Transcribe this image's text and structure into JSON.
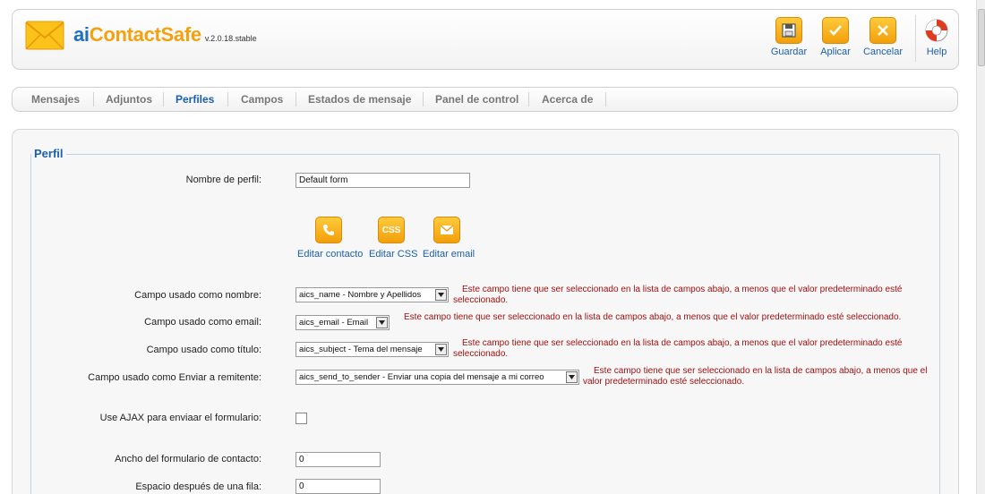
{
  "header": {
    "brand_ai": "ai",
    "brand_rest": "ContactSafe",
    "version": "v.2.0.18.stable",
    "buttons": {
      "save": "Guardar",
      "apply": "Aplicar",
      "cancel": "Cancelar",
      "help": "Help"
    }
  },
  "tabs": [
    {
      "label": "Mensajes"
    },
    {
      "label": "Adjuntos"
    },
    {
      "label": "Perfiles"
    },
    {
      "label": "Campos"
    },
    {
      "label": "Estados de mensaje"
    },
    {
      "label": "Panel de control"
    },
    {
      "label": "Acerca de"
    }
  ],
  "active_tab": "Perfiles",
  "form": {
    "legend": "Perfil",
    "profile_name_label": "Nombre de perfil:",
    "profile_name_value": "Default form",
    "actions": {
      "edit_contact": "Editar contacto",
      "edit_css": "Editar CSS",
      "edit_css_icon_text": "CSS",
      "edit_email": "Editar email"
    },
    "name_field_label": "Campo usado como nombre:",
    "name_field_value": "aics_name - Nombre y Apellidos",
    "email_field_label": "Campo usado como email:",
    "email_field_value": "aics_email - Email",
    "title_field_label": "Campo usado como título:",
    "title_field_value": "aics_subject - Tema del mensaje",
    "sender_field_label": "Campo usado como Enviar a remitente:",
    "sender_field_value": "aics_send_to_sender - Enviar una copia del mensaje a mi correo",
    "note_name": "Este campo tiene que ser seleccionado en la lista de campos abajo, a menos que el valor predeterminado esté seleccionado.",
    "note_email": "Este campo tiene que ser seleccionado en la lista de campos abajo, a menos que el valor predeterminado esté seleccionado.",
    "note_title": "Este campo tiene que ser seleccionado en la lista de campos abajo, a menos que el valor predeterminado esté seleccionado.",
    "note_sender": "Este campo tiene que ser seleccionado en la lista de campos abajo, a menos que el valor predeterminado esté seleccionado.",
    "ajax_label": "Use AJAX para enviaar el formulario:",
    "ajax_checked": false,
    "width_label": "Ancho del formulario de contacto:",
    "width_value": "0",
    "row_space_label": "Espacio después de una fila:",
    "row_space_value": "0"
  },
  "colors": {
    "accent_blue": "#1a5fae",
    "icon_orange": "#f29f0b",
    "note_red": "#a01010"
  }
}
